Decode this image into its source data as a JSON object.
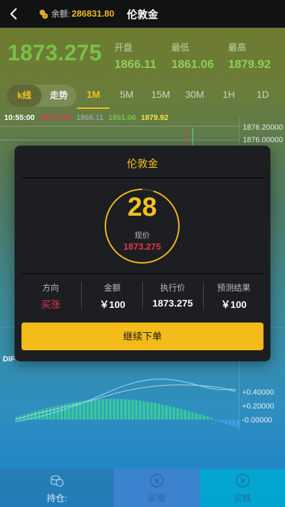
{
  "topbar": {
    "back_icon": "chevron-left-icon",
    "balance_label": "余额:",
    "balance_value": "286831.80",
    "title": "伦敦金"
  },
  "quote": {
    "price": "1873.275",
    "open_label": "开盘",
    "open_value": "1866.11",
    "low_label": "最低",
    "low_value": "1861.06",
    "high_label": "最高",
    "high_value": "1879.92"
  },
  "tabs": {
    "kline_label": "k线",
    "trend_label": "走势",
    "timeframes": [
      "1M",
      "5M",
      "15M",
      "30M",
      "1H",
      "1D"
    ],
    "active_timeframe": "1M"
  },
  "ohlc": {
    "time": "10:55:00",
    "o": "1873.275",
    "c": "1866.11",
    "l": "1861.06",
    "h": "1879.92"
  },
  "chart": {
    "price_axis": [
      "1876.20000",
      "1876.00000"
    ],
    "macd_axis": [
      "+0.40000",
      "+0.20000",
      "-0.00000"
    ],
    "dif_label": "DIF"
  },
  "modal": {
    "title": "伦敦金",
    "countdown": "28",
    "progress": 0.05,
    "now_label": "现价",
    "now_value": "1873.275",
    "direction_label": "方向",
    "direction_value": "买涨",
    "amount_label": "金额",
    "amount_value": "￥100",
    "strike_label": "执行价",
    "strike_value": "1873.275",
    "result_label": "预测结果",
    "result_value": "￥100",
    "continue_label": "继续下单"
  },
  "bottom": {
    "hold_label": "持仓:",
    "buy_up_label": "买涨",
    "buy_down_label": "买跌"
  },
  "colors": {
    "accent": "#f3c21e",
    "up_red": "#e2344a",
    "green": "#79c148"
  }
}
